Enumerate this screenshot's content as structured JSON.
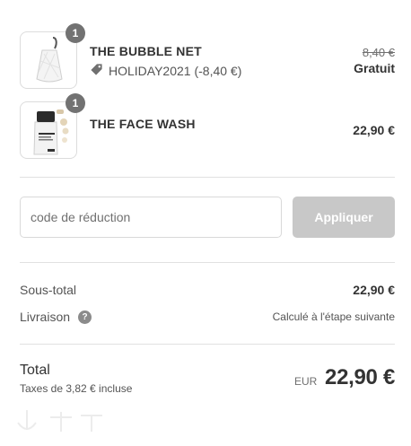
{
  "cart": {
    "items": [
      {
        "quantity": "1",
        "name": "THE BUBBLE NET",
        "discount_code": "HOLIDAY2021 (-8,40 €)",
        "original_price": "8,40 €",
        "price": "Gratuit",
        "icon": "tag-icon"
      },
      {
        "quantity": "1",
        "name": "THE FACE WASH",
        "price": "22,90 €"
      }
    ]
  },
  "discount": {
    "placeholder": "code de réduction",
    "value": "",
    "apply_label": "Appliquer"
  },
  "summary": {
    "subtotal_label": "Sous-total",
    "subtotal_value": "22,90 €",
    "shipping_label": "Livraison",
    "shipping_value": "Calculé à l'étape suivante",
    "help_icon_glyph": "?"
  },
  "total": {
    "label": "Total",
    "tax_note": "Taxes de 3,82 € incluse",
    "currency": "EUR",
    "amount": "22,90 €"
  },
  "colors": {
    "badge": "#727272",
    "button_disabled": "#c8c8c8",
    "divider": "#e1e1e1",
    "text_primary": "#333333",
    "text_secondary": "#545454"
  }
}
